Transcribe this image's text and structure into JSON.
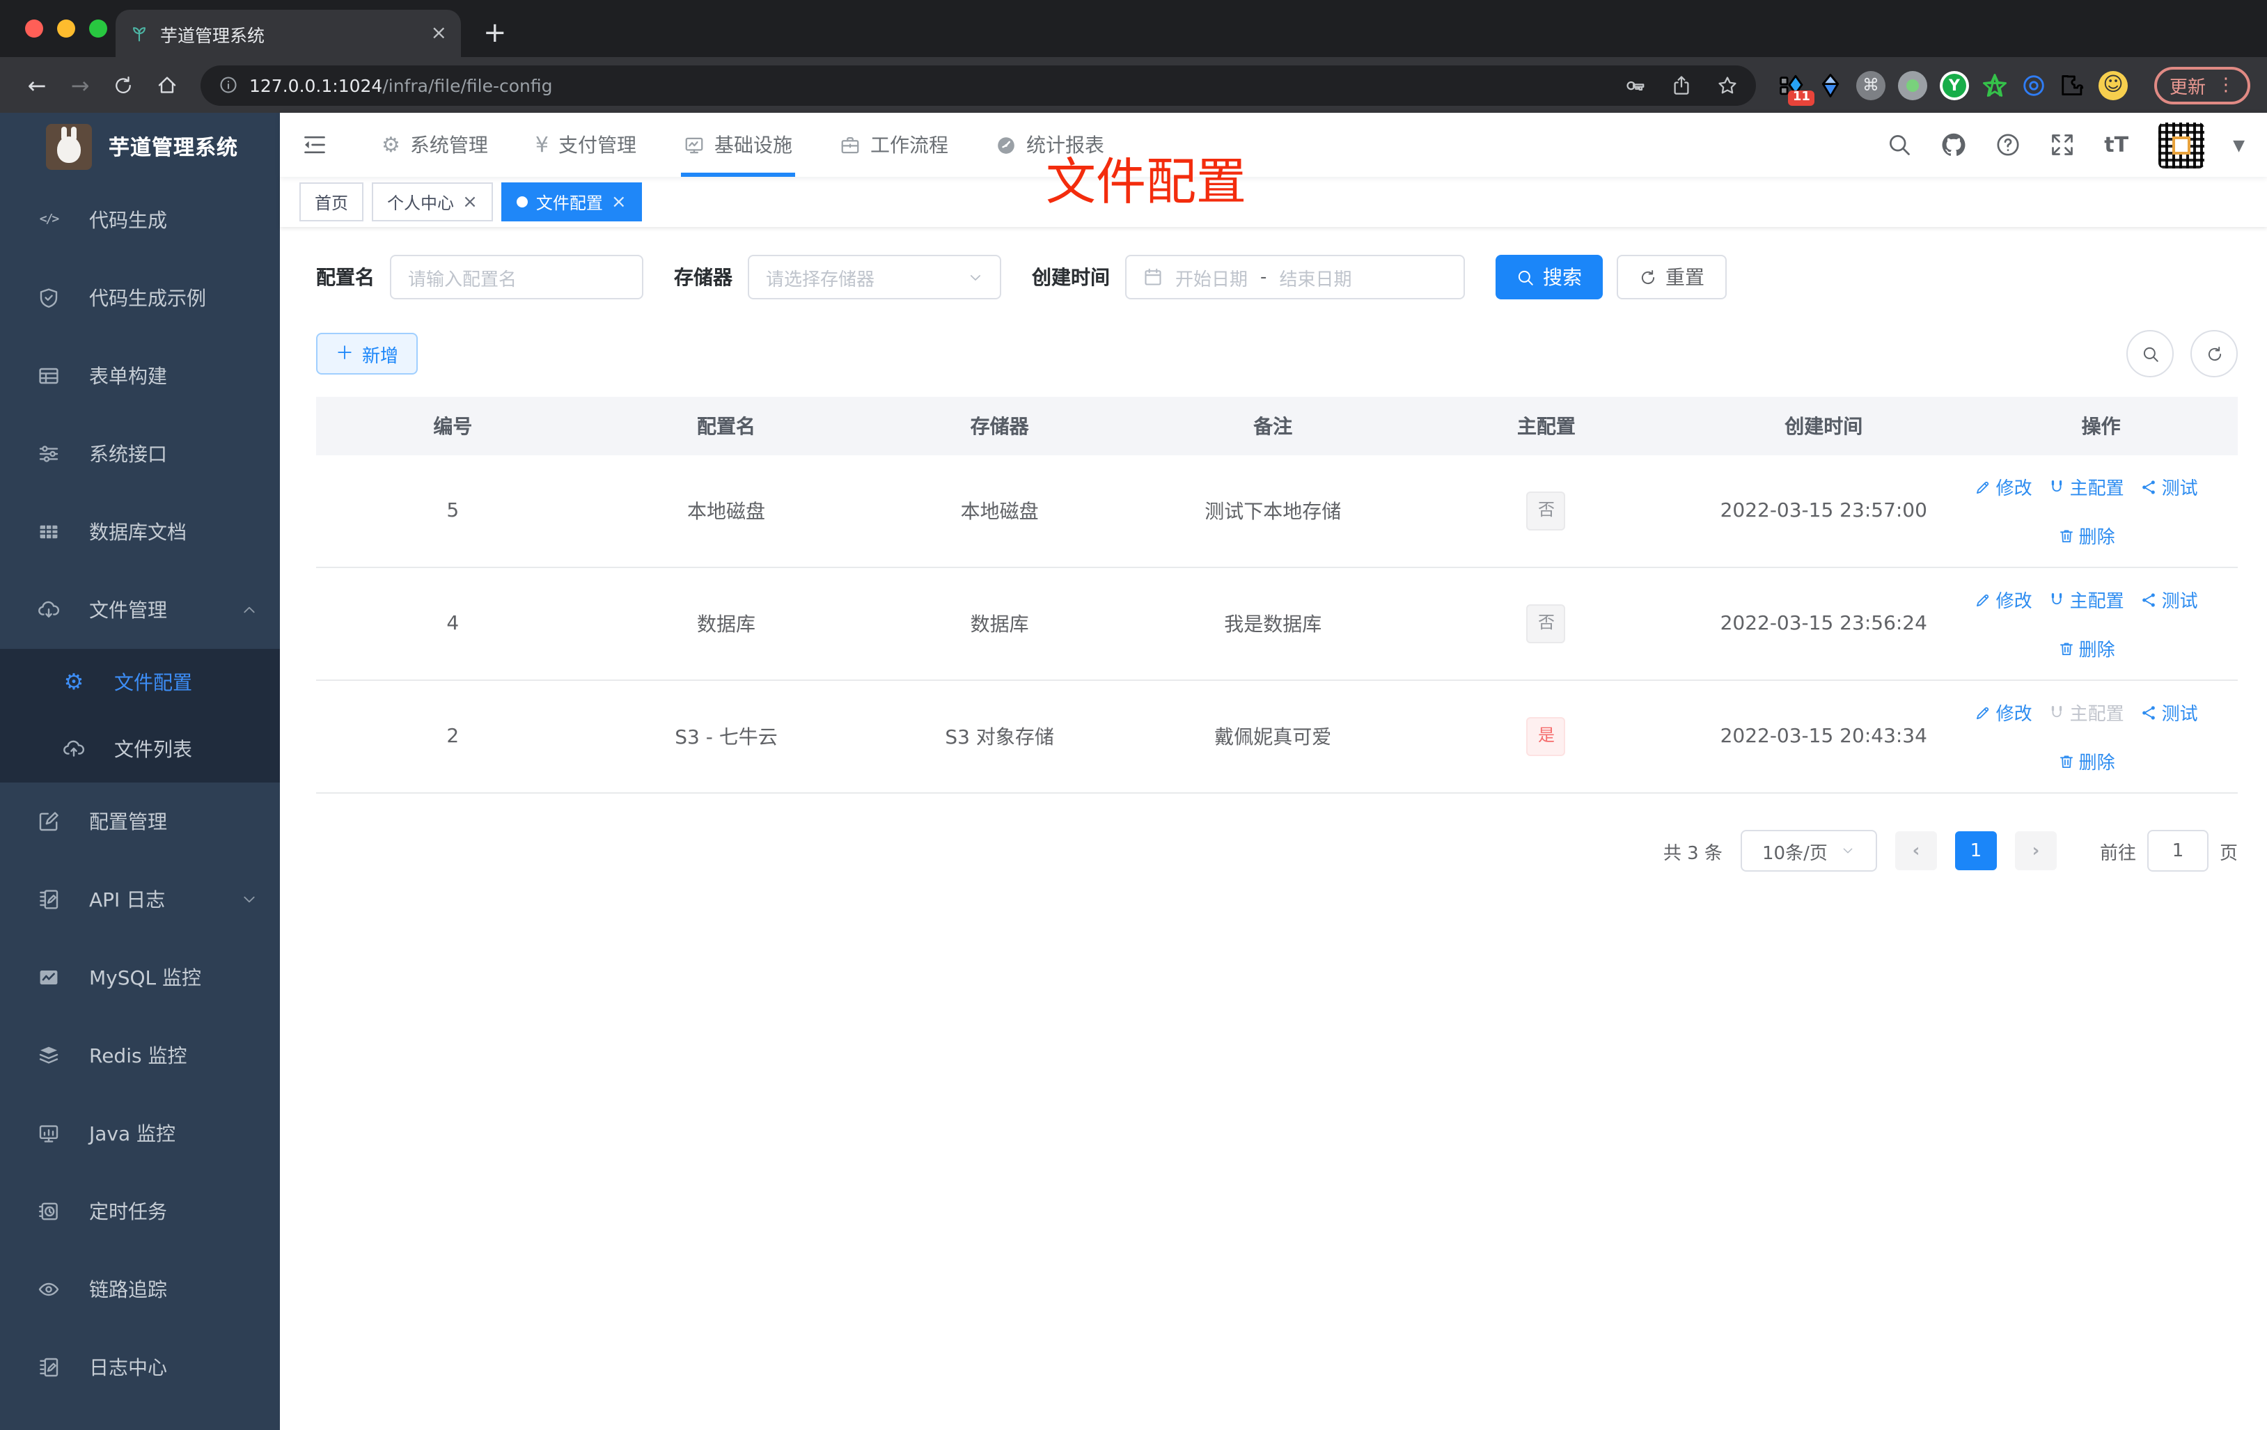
{
  "browser": {
    "tab_title": "芋道管理系统",
    "url_host": "127.0.0.1:1024",
    "url_path": "/infra/file/file-config",
    "update_label": "更新",
    "ext_badge": "11"
  },
  "annotation": {
    "text": "文件配置"
  },
  "app": {
    "logo_title": "芋道管理系统"
  },
  "nav": {
    "items": [
      {
        "icon": "gear-filled-icon",
        "label": "系统管理"
      },
      {
        "icon": "yen-icon",
        "label": "支付管理"
      },
      {
        "icon": "infra-icon",
        "label": "基础设施",
        "active": true
      },
      {
        "icon": "briefcase-icon",
        "label": "工作流程"
      },
      {
        "icon": "report-icon",
        "label": "统计报表"
      }
    ]
  },
  "sidebar": {
    "items": [
      {
        "icon": "code-icon",
        "label": "代码生成"
      },
      {
        "icon": "shield-check-icon",
        "label": "代码生成示例"
      },
      {
        "icon": "form-build-icon",
        "label": "表单构建"
      },
      {
        "icon": "sliders-icon",
        "label": "系统接口"
      },
      {
        "icon": "db-doc-icon",
        "label": "数据库文档"
      },
      {
        "icon": "cloud-download-icon",
        "label": "文件管理",
        "chevron_icon": "chevron-up-icon"
      },
      {
        "icon": "gear-icon",
        "label": "文件配置",
        "sub": true,
        "active": true
      },
      {
        "icon": "cloud-upload-icon",
        "label": "文件列表",
        "sub": true
      },
      {
        "icon": "edit-square-icon",
        "label": "配置管理"
      },
      {
        "icon": "api-log-icon",
        "label": "API 日志",
        "chevron_icon": "chevron-down-icon"
      },
      {
        "icon": "mysql-monitor-icon",
        "label": "MySQL 监控"
      },
      {
        "icon": "redis-monitor-icon",
        "label": "Redis 监控"
      },
      {
        "icon": "java-monitor-icon",
        "label": "Java 监控"
      },
      {
        "icon": "timer-icon",
        "label": "定时任务"
      },
      {
        "icon": "trace-icon",
        "label": "链路追踪"
      },
      {
        "icon": "log-center-icon",
        "label": "日志中心"
      }
    ]
  },
  "tags": {
    "items": [
      {
        "label": "首页"
      },
      {
        "label": "个人中心",
        "closable": true
      },
      {
        "label": "文件配置",
        "closable": true,
        "active": true,
        "dot": true
      }
    ]
  },
  "filters": {
    "name_label": "配置名",
    "name_placeholder": "请输入配置名",
    "storage_label": "存储器",
    "storage_placeholder": "请选择存储器",
    "time_label": "创建时间",
    "start_placeholder": "开始日期",
    "range_separator": "-",
    "end_placeholder": "结束日期",
    "search_label": "搜索",
    "reset_label": "重置",
    "add_label": "新增"
  },
  "table": {
    "columns": [
      "编号",
      "配置名",
      "存储器",
      "备注",
      "主配置",
      "创建时间",
      "操作"
    ],
    "rows": [
      {
        "id": "5",
        "name": "本地磁盘",
        "storage": "本地磁盘",
        "remark": "测试下本地存储",
        "tag": "否",
        "tag_danger": false,
        "time": "2022-03-15 23:57:00",
        "edit": "修改",
        "primary": "主配置",
        "primary_disabled": false,
        "test": "测试",
        "del": "删除"
      },
      {
        "id": "4",
        "name": "数据库",
        "storage": "数据库",
        "remark": "我是数据库",
        "tag": "否",
        "tag_danger": false,
        "time": "2022-03-15 23:56:24",
        "edit": "修改",
        "primary": "主配置",
        "primary_disabled": false,
        "test": "测试",
        "del": "删除"
      },
      {
        "id": "2",
        "name": "S3 - 七牛云",
        "storage": "S3 对象存储",
        "remark": "戴佩妮真可爱",
        "tag": "是",
        "tag_danger": true,
        "time": "2022-03-15 20:43:34",
        "edit": "修改",
        "primary": "主配置",
        "primary_disabled": true,
        "test": "测试",
        "del": "删除"
      }
    ]
  },
  "pagination": {
    "total_label": "共 3 条",
    "page_size": "10条/页",
    "current_page": "1",
    "goto_label": "前往",
    "goto_value": "1",
    "page_unit": "页"
  }
}
